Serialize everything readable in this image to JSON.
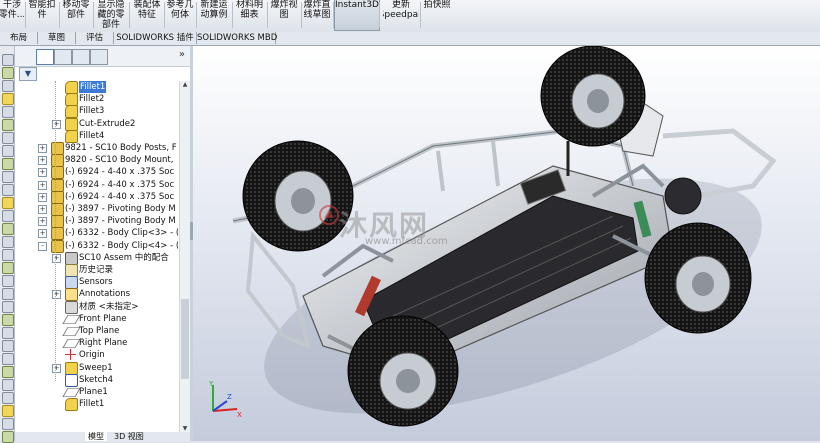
{
  "ribbon": {
    "buttons": [
      {
        "l1": "干涉",
        "l2": "零件...",
        "active": false
      },
      {
        "l1": "智能扣",
        "l2": "件",
        "active": false
      },
      {
        "l1": "移动零",
        "l2": "部件",
        "active": false
      },
      {
        "l1": "显示隐",
        "l2": "藏的零\n部件",
        "active": false
      },
      {
        "l1": "装配体",
        "l2": "特征",
        "active": false
      },
      {
        "l1": "参考几",
        "l2": "何体",
        "active": false
      },
      {
        "l1": "新建运",
        "l2": "动算例",
        "active": false
      },
      {
        "l1": "材料明",
        "l2": "细表",
        "active": false
      },
      {
        "l1": "爆炸视",
        "l2": "图",
        "active": false
      },
      {
        "l1": "爆炸直",
        "l2": "线草图",
        "active": false
      },
      {
        "l1": "Instant3D",
        "l2": "",
        "active": true
      },
      {
        "l1": "更新",
        "l2": "Speedpak",
        "active": false
      },
      {
        "l1": "拍快照",
        "l2": "",
        "active": false
      }
    ]
  },
  "command_tabs": [
    {
      "label": "布局",
      "active": false
    },
    {
      "label": "草图",
      "active": false
    },
    {
      "label": "评估",
      "active": false
    },
    {
      "label": "SOLIDWORKS 插件",
      "active": false
    },
    {
      "label": "SOLIDWORKS MBD",
      "active": false
    }
  ],
  "feature_tree": {
    "rows": [
      {
        "label": "Fillet1",
        "icon": "fillet-icon",
        "indent": 2,
        "expander": "",
        "selected": true
      },
      {
        "label": "Fillet2",
        "icon": "fillet-icon",
        "indent": 2,
        "expander": "",
        "selected": false
      },
      {
        "label": "Fillet3",
        "icon": "fillet-icon",
        "indent": 2,
        "expander": "",
        "selected": false
      },
      {
        "label": "Cut-Extrude2",
        "icon": "cut-extrude-icon",
        "indent": 2,
        "expander": "+",
        "selected": false
      },
      {
        "label": "Fillet4",
        "icon": "fillet-icon",
        "indent": 2,
        "expander": "",
        "selected": false
      },
      {
        "label": "9821 - SC10 Body Posts, F",
        "icon": "part-icon",
        "indent": 1,
        "expander": "+",
        "selected": false
      },
      {
        "label": "9820 - SC10 Body Mount,",
        "icon": "part-icon",
        "indent": 1,
        "expander": "+",
        "selected": false
      },
      {
        "label": "(-) 6924 - 4-40 x .375 Soc",
        "icon": "part-icon",
        "indent": 1,
        "expander": "+",
        "selected": false
      },
      {
        "label": "(-) 6924 - 4-40 x .375 Soc",
        "icon": "part-icon",
        "indent": 1,
        "expander": "+",
        "selected": false
      },
      {
        "label": "(-) 6924 - 4-40 x .375 Soc",
        "icon": "part-icon",
        "indent": 1,
        "expander": "+",
        "selected": false
      },
      {
        "label": "(-) 3897 - Pivoting Body M",
        "icon": "part-icon",
        "indent": 1,
        "expander": "+",
        "selected": false
      },
      {
        "label": "(-) 3897 - Pivoting Body M",
        "icon": "part-icon",
        "indent": 1,
        "expander": "+",
        "selected": false
      },
      {
        "label": "(-) 6332 - Body Clip<3> - (",
        "icon": "part-icon",
        "indent": 1,
        "expander": "+",
        "selected": false
      },
      {
        "label": "(-) 6332 - Body Clip<4> - (",
        "icon": "part-icon",
        "indent": 1,
        "expander": "-",
        "selected": false
      },
      {
        "label": "SC10 Assem 中的配合",
        "icon": "mates-icon",
        "indent": 2,
        "expander": "+",
        "selected": false
      },
      {
        "label": "历史记录",
        "icon": "history-icon",
        "indent": 2,
        "expander": "",
        "selected": false
      },
      {
        "label": "Sensors",
        "icon": "sensors-icon",
        "indent": 2,
        "expander": "",
        "selected": false
      },
      {
        "label": "Annotations",
        "icon": "annotations-icon",
        "indent": 2,
        "expander": "+",
        "selected": false
      },
      {
        "label": "材质 <未指定>",
        "icon": "material-icon",
        "indent": 2,
        "expander": "",
        "selected": false
      },
      {
        "label": "Front Plane",
        "icon": "plane-icon",
        "indent": 2,
        "expander": "",
        "selected": false
      },
      {
        "label": "Top Plane",
        "icon": "plane-icon",
        "indent": 2,
        "expander": "",
        "selected": false
      },
      {
        "label": "Right Plane",
        "icon": "plane-icon",
        "indent": 2,
        "expander": "",
        "selected": false
      },
      {
        "label": "Origin",
        "icon": "origin-icon",
        "indent": 2,
        "expander": "",
        "selected": false
      },
      {
        "label": "Sweep1",
        "icon": "sweep-icon",
        "indent": 2,
        "expander": "+",
        "selected": false
      },
      {
        "label": "Sketch4",
        "icon": "sketch-icon",
        "indent": 2,
        "expander": "",
        "selected": false
      },
      {
        "label": "Plane1",
        "icon": "plane-icon",
        "indent": 2,
        "expander": "",
        "selected": false
      },
      {
        "label": "Fillet1",
        "icon": "fillet-icon",
        "indent": 2,
        "expander": "",
        "selected": false
      }
    ]
  },
  "bottom_tabs": [
    {
      "label": "模型",
      "active": true
    },
    {
      "label": "3D 视图",
      "active": false
    }
  ],
  "view_toolbar_icons": [
    "zoom-to-fit-icon",
    "zoom-area-icon",
    "previous-view-icon",
    "section-view-icon",
    "view-orientation-icon",
    "display-style-icon",
    "hide-show-icon",
    "edit-appearance-icon",
    "scene-icon",
    "display-settings-icon"
  ],
  "watermark": {
    "text": "沐风网",
    "sub": "www.mfcad.com"
  },
  "colors": {
    "selection": "#3b7bd6",
    "ribbon_bg": "#e6eaef",
    "viewport_top": "#ffffff",
    "viewport_bottom": "#c4cbdb",
    "tire": "#1b1b1b",
    "chassis": "#c8ccd2"
  }
}
